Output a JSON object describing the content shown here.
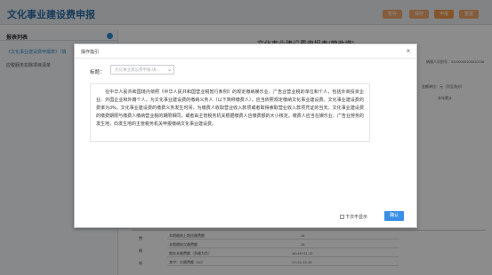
{
  "app": {
    "title": "文化事业建设费申报",
    "top_buttons": [
      "暂存",
      "保存",
      "申报",
      "重置"
    ]
  },
  "sidebar": {
    "header": "报表列表",
    "items": [
      "《文化事业建设费申报表》（填",
      "应税服务扣除项目清单"
    ]
  },
  "main": {
    "title": "文化事业建设费申报表(营改增)",
    "taxpayer_no": "纳税人识别号：91110000100010706",
    "unit_label": "金额单位：元（列至角分）",
    "col_header": "本年累计",
    "rows": [
      {
        "label": "本期缴纳上期应缴费额",
        "line": "14"
      },
      {
        "label": "本期缴纳欠缴费额",
        "line": "15"
      },
      {
        "label": "期末未缴费额（多缴为负）",
        "line": "16=10+11-12"
      },
      {
        "label": "其中：欠缴费额（≥0）",
        "line": "17=11-14-15"
      }
    ],
    "side_chars": [
      "费",
      "缴",
      "纳"
    ]
  },
  "modal": {
    "title": "操作指引",
    "close_glyph": "×",
    "field_label": "标题：",
    "select_value": "文化事业建设费申报-填...",
    "content": "在中华人民共和国境内依照《中华人民共和国营业税暂行条例》的规定缴纳娱乐业、广告业营业税的单位和个人，包括外商投资企业、外国企业和外籍个人，为文化事业建设费的缴纳义务人（以下简称缴费人），应当依照规定缴纳文化事业建设费。文化事业建设费的费率为3%。文化事业建设费的缴费义务发生时间，为缴费人收取营业收入款项或者取得索取营业收入款项凭证的当天。文化事业建设费的缴费期限与缴费人缴纳营业税的期限相同，或者由主管税务机关根据缴费人应缴费额的大小核定。缴费人应当在娱乐业、广告业劳务的发生地，向发生地的主管税务机关申报缴纳文化事业建设费。",
    "no_more_label": "下次不显示",
    "confirm_label": "确认"
  }
}
